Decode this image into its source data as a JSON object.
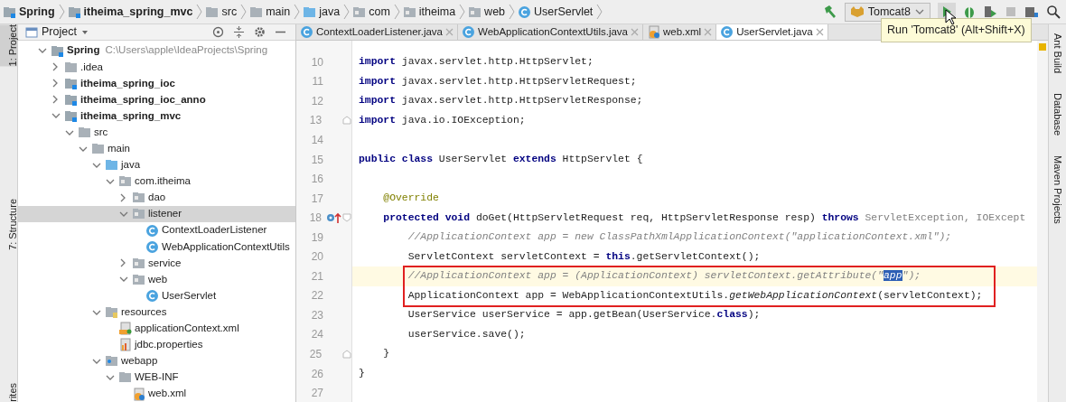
{
  "breadcrumb": [
    {
      "label": "Spring",
      "kind": "module"
    },
    {
      "label": "itheima_spring_mvc",
      "kind": "module"
    },
    {
      "label": "src",
      "kind": "folder"
    },
    {
      "label": "main",
      "kind": "folder"
    },
    {
      "label": "java",
      "kind": "source"
    },
    {
      "label": "com",
      "kind": "package"
    },
    {
      "label": "itheima",
      "kind": "package"
    },
    {
      "label": "web",
      "kind": "package"
    },
    {
      "label": "UserServlet",
      "kind": "class"
    }
  ],
  "run_config": {
    "label": "Tomcat8"
  },
  "tooltip": "Run 'Tomcat8' (Alt+Shift+X)",
  "left_strip": [
    {
      "label": "1: Project",
      "selected": true
    },
    {
      "label": "7: Structure",
      "selected": false
    },
    {
      "label": "rites",
      "selected": false
    }
  ],
  "right_strip": [
    "Ant Build",
    "Database",
    "Maven Projects"
  ],
  "project_panel": {
    "title": "Project",
    "tree": [
      {
        "label": "Spring",
        "kind": "module",
        "path": "C:\\Users\\apple\\IdeaProjects\\Spring",
        "expanded": true,
        "selected": false,
        "children": [
          {
            "label": ".idea",
            "kind": "folder",
            "expanded": false,
            "selected": false
          },
          {
            "label": "itheima_spring_ioc",
            "kind": "module",
            "expanded": false,
            "selected": false
          },
          {
            "label": "itheima_spring_ioc_anno",
            "kind": "module",
            "expanded": false,
            "selected": false
          },
          {
            "label": "itheima_spring_mvc",
            "kind": "module",
            "expanded": true,
            "selected": false,
            "children": [
              {
                "label": "src",
                "kind": "folder",
                "expanded": true,
                "selected": false,
                "children": [
                  {
                    "label": "main",
                    "kind": "folder",
                    "expanded": true,
                    "selected": false,
                    "children": [
                      {
                        "label": "java",
                        "kind": "source",
                        "expanded": true,
                        "selected": false,
                        "children": [
                          {
                            "label": "com.itheima",
                            "kind": "package",
                            "expanded": true,
                            "selected": false,
                            "children": [
                              {
                                "label": "dao",
                                "kind": "package",
                                "expanded": false,
                                "selected": false
                              },
                              {
                                "label": "listener",
                                "kind": "package",
                                "expanded": true,
                                "selected": true,
                                "children": [
                                  {
                                    "label": "ContextLoaderListener",
                                    "kind": "class",
                                    "selected": false
                                  },
                                  {
                                    "label": "WebApplicationContextUtils",
                                    "kind": "class",
                                    "selected": false
                                  }
                                ]
                              },
                              {
                                "label": "service",
                                "kind": "package",
                                "expanded": false,
                                "selected": false
                              },
                              {
                                "label": "web",
                                "kind": "package",
                                "expanded": true,
                                "selected": false,
                                "children": [
                                  {
                                    "label": "UserServlet",
                                    "kind": "class",
                                    "selected": false
                                  }
                                ]
                              }
                            ]
                          }
                        ]
                      },
                      {
                        "label": "resources",
                        "kind": "resources",
                        "expanded": true,
                        "selected": false,
                        "children": [
                          {
                            "label": "applicationContext.xml",
                            "kind": "xml",
                            "selected": false
                          },
                          {
                            "label": "jdbc.properties",
                            "kind": "properties",
                            "selected": false
                          }
                        ]
                      },
                      {
                        "label": "webapp",
                        "kind": "webapp",
                        "expanded": true,
                        "selected": false,
                        "children": [
                          {
                            "label": "WEB-INF",
                            "kind": "folder",
                            "expanded": true,
                            "selected": false,
                            "children": [
                              {
                                "label": "web.xml",
                                "kind": "webxml",
                                "selected": false
                              }
                            ]
                          }
                        ]
                      }
                    ]
                  }
                ]
              }
            ]
          }
        ]
      }
    ]
  },
  "tabs": [
    {
      "label": "ContextLoaderListener.java",
      "kind": "class",
      "selected": false
    },
    {
      "label": "WebApplicationContextUtils.java",
      "kind": "class",
      "selected": false
    },
    {
      "label": "web.xml",
      "kind": "webxml",
      "selected": false
    },
    {
      "label": "UserServlet.java",
      "kind": "class",
      "selected": true
    }
  ],
  "code": [
    {
      "number": "10",
      "tokens": [
        {
          "kind": "kw",
          "text": "import"
        },
        {
          "kind": "plain",
          "text": " javax.servlet.http.HttpServlet;"
        }
      ]
    },
    {
      "number": "11",
      "tokens": [
        {
          "kind": "kw",
          "text": "import"
        },
        {
          "kind": "plain",
          "text": " javax.servlet.http.HttpServletRequest;"
        }
      ]
    },
    {
      "number": "12",
      "tokens": [
        {
          "kind": "kw",
          "text": "import"
        },
        {
          "kind": "plain",
          "text": " javax.servlet.http.HttpServletResponse;"
        }
      ]
    },
    {
      "number": "13",
      "fold_end": true,
      "tokens": [
        {
          "kind": "kw",
          "text": "import"
        },
        {
          "kind": "plain",
          "text": " java.io.IOException;"
        }
      ]
    },
    {
      "number": "14"
    },
    {
      "number": "15",
      "tokens": [
        {
          "kind": "kw",
          "text": "public class"
        },
        {
          "kind": "plain",
          "text": " UserServlet "
        },
        {
          "kind": "kw",
          "text": "extends"
        },
        {
          "kind": "plain",
          "text": " HttpServlet {"
        }
      ]
    },
    {
      "number": "16"
    },
    {
      "number": "17",
      "tokens": [
        {
          "kind": "annotation",
          "text": "    @Override"
        }
      ]
    },
    {
      "number": "18",
      "fold_start": true,
      "override_marker": true,
      "tokens": [
        {
          "kind": "kw",
          "text": "    protected void"
        },
        {
          "kind": "plain",
          "text": " doGet(HttpServletRequest req, HttpServletResponse resp) "
        },
        {
          "kind": "kw",
          "text": "throws"
        },
        {
          "kind": "dim",
          "text": " ServletException, IOExcept"
        }
      ]
    },
    {
      "number": "19",
      "tokens": [
        {
          "kind": "comment",
          "text": "        //ApplicationContext app = new ClassPathXmlApplicationContext(\"applicationContext.xml\");"
        }
      ]
    },
    {
      "number": "20",
      "tokens": [
        {
          "kind": "plain",
          "text": "        ServletContext servletContext = "
        },
        {
          "kind": "kw",
          "text": "this"
        },
        {
          "kind": "plain",
          "text": ".getServletContext();"
        }
      ]
    },
    {
      "number": "21",
      "current": true,
      "boxed": true,
      "tokens": [
        {
          "kind": "comment",
          "text": "        //ApplicationContext app = (ApplicationContext) servletContext.getAttribute(\""
        },
        {
          "kind": "selected",
          "text": "app"
        },
        {
          "kind": "comment",
          "text": "\");"
        }
      ]
    },
    {
      "number": "22",
      "boxed": true,
      "tokens": [
        {
          "kind": "plain",
          "text": "        ApplicationContext app = WebApplicationContextUtils."
        },
        {
          "kind": "static",
          "text": "getWebApplicationContext"
        },
        {
          "kind": "plain",
          "text": "(servletContext);"
        }
      ]
    },
    {
      "number": "23",
      "tokens": [
        {
          "kind": "plain",
          "text": "        UserService userService = app.getBean(UserService."
        },
        {
          "kind": "kw",
          "text": "class"
        },
        {
          "kind": "plain",
          "text": ");"
        }
      ]
    },
    {
      "number": "24",
      "tokens": [
        {
          "kind": "plain",
          "text": "        userService.save();"
        }
      ]
    },
    {
      "number": "25",
      "fold_end": true,
      "tokens": [
        {
          "kind": "plain",
          "text": "    }"
        }
      ]
    },
    {
      "number": "26",
      "tokens": [
        {
          "kind": "plain",
          "text": "}"
        }
      ]
    },
    {
      "number": "27"
    }
  ]
}
